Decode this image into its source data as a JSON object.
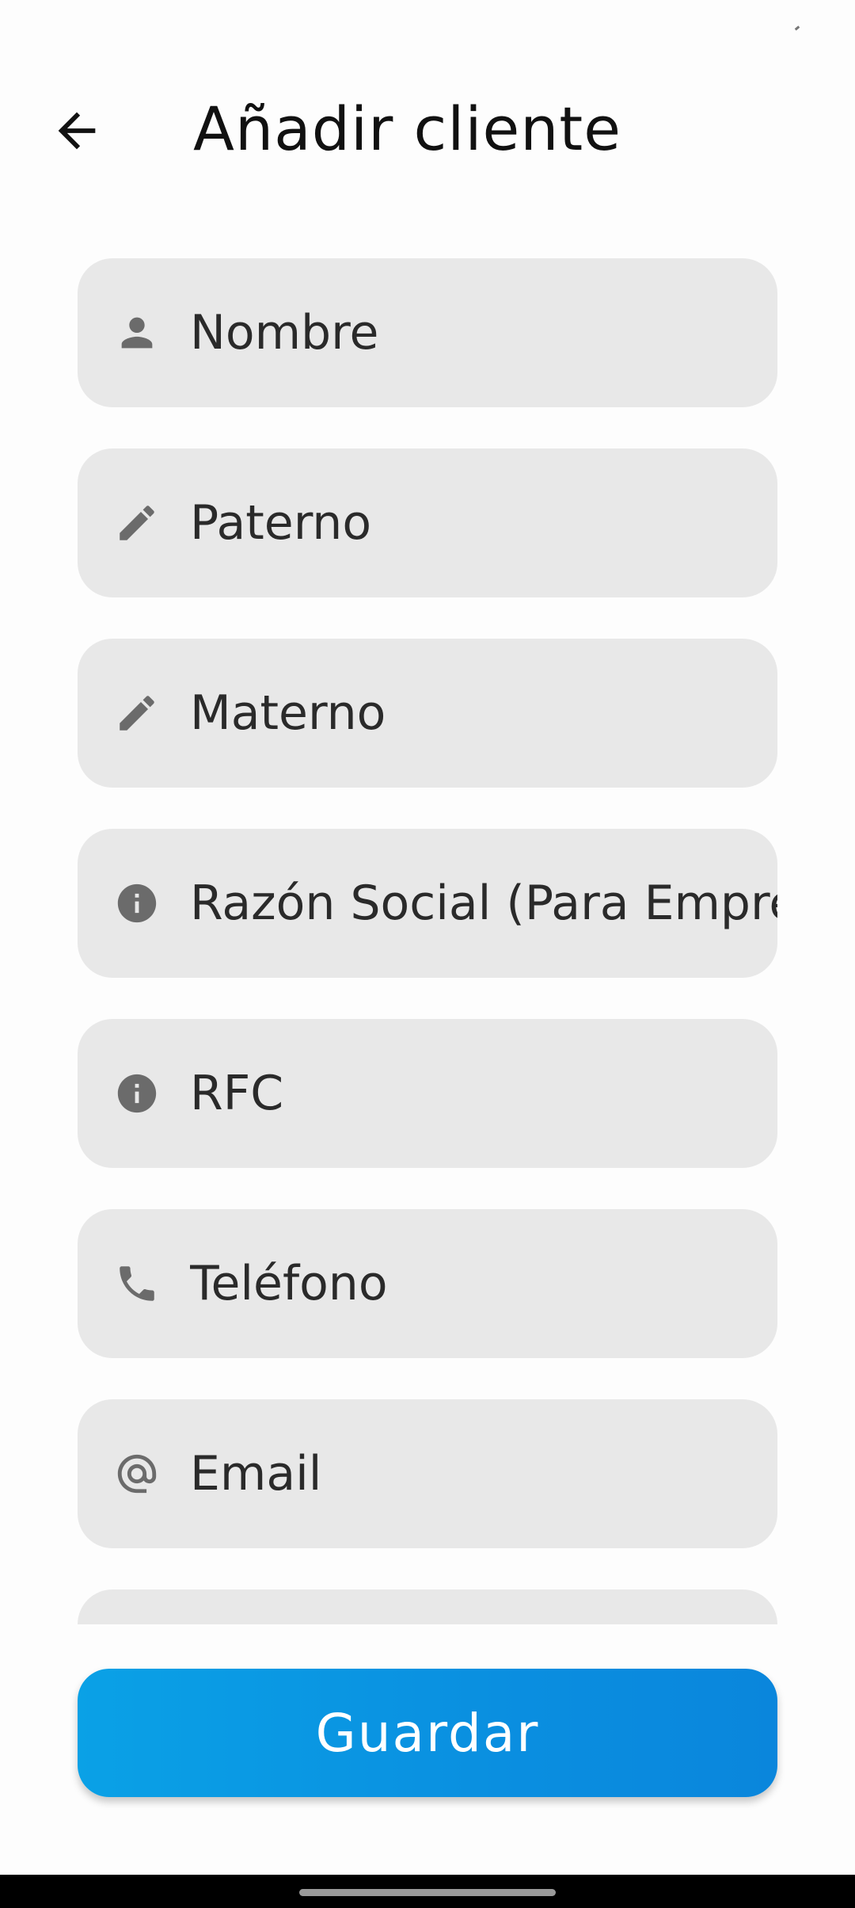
{
  "header": {
    "title": "Añadir cliente",
    "back_icon": "arrow-left-icon"
  },
  "form": {
    "fields": [
      {
        "placeholder": "Nombre",
        "value": "",
        "icon": "person-icon"
      },
      {
        "placeholder": "Paterno",
        "value": "",
        "icon": "pencil-icon"
      },
      {
        "placeholder": "Materno",
        "value": "",
        "icon": "pencil-icon"
      },
      {
        "placeholder": "Razón Social (Para Empresas)",
        "value": "",
        "icon": "info-icon"
      },
      {
        "placeholder": "RFC",
        "value": "",
        "icon": "info-icon"
      },
      {
        "placeholder": "Teléfono",
        "value": "",
        "icon": "phone-icon"
      },
      {
        "placeholder": "Email",
        "value": "",
        "icon": "at-sign-icon"
      }
    ]
  },
  "actions": {
    "save_label": "Guardar"
  },
  "colors": {
    "field_background": "#e8e8e8",
    "icon": "#6b6b6b",
    "button_start": "#0aa1e6",
    "button_end": "#0a86dc",
    "button_text": "#ffffff"
  }
}
